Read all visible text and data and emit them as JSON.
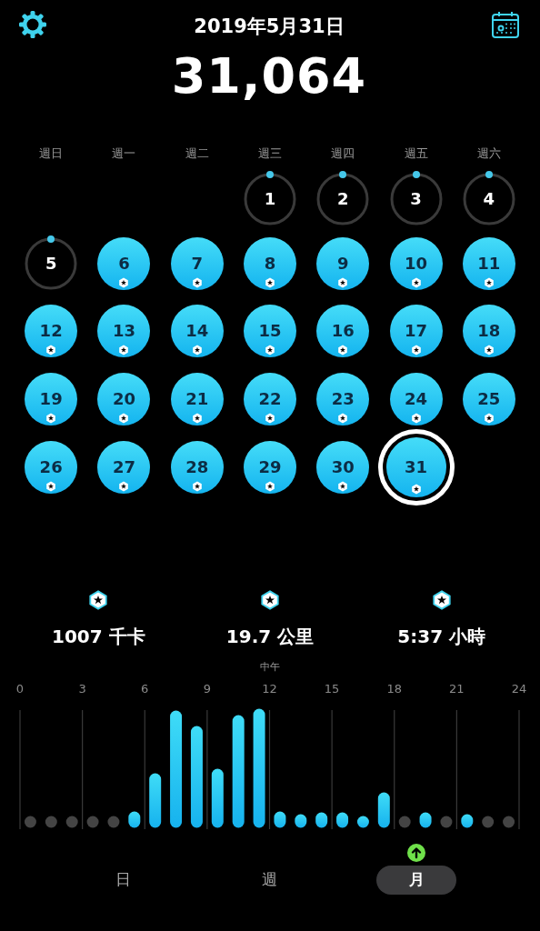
{
  "header": {
    "date": "2019年5月31日",
    "steps": "31,064"
  },
  "weekdays": [
    "週日",
    "週一",
    "週二",
    "週三",
    "週四",
    "週五",
    "週六"
  ],
  "weeks": [
    [
      {
        "day": "1",
        "kind": "ring",
        "selected": false
      },
      {
        "day": "2",
        "kind": "ring",
        "selected": false
      },
      {
        "day": "3",
        "kind": "ring",
        "selected": false
      },
      {
        "day": "4",
        "kind": "ring",
        "selected": false
      }
    ],
    [
      {
        "day": "5",
        "kind": "ring",
        "selected": false
      },
      {
        "day": "6",
        "kind": "goal",
        "selected": false
      },
      {
        "day": "7",
        "kind": "goal",
        "selected": false
      },
      {
        "day": "8",
        "kind": "goal",
        "selected": false
      },
      {
        "day": "9",
        "kind": "goal",
        "selected": false
      },
      {
        "day": "10",
        "kind": "goal",
        "selected": false
      },
      {
        "day": "11",
        "kind": "goal",
        "selected": false
      }
    ],
    [
      {
        "day": "12",
        "kind": "goal",
        "selected": false
      },
      {
        "day": "13",
        "kind": "goal",
        "selected": false
      },
      {
        "day": "14",
        "kind": "goal",
        "selected": false
      },
      {
        "day": "15",
        "kind": "goal",
        "selected": false
      },
      {
        "day": "16",
        "kind": "goal",
        "selected": false
      },
      {
        "day": "17",
        "kind": "goal",
        "selected": false
      },
      {
        "day": "18",
        "kind": "goal",
        "selected": false
      }
    ],
    [
      {
        "day": "19",
        "kind": "goal",
        "selected": false
      },
      {
        "day": "20",
        "kind": "goal",
        "selected": false
      },
      {
        "day": "21",
        "kind": "goal",
        "selected": false
      },
      {
        "day": "22",
        "kind": "goal",
        "selected": false
      },
      {
        "day": "23",
        "kind": "goal",
        "selected": false
      },
      {
        "day": "24",
        "kind": "goal",
        "selected": false
      },
      {
        "day": "25",
        "kind": "goal",
        "selected": false
      }
    ],
    [
      {
        "day": "26",
        "kind": "goal",
        "selected": false
      },
      {
        "day": "27",
        "kind": "goal",
        "selected": false
      },
      {
        "day": "28",
        "kind": "goal",
        "selected": false
      },
      {
        "day": "29",
        "kind": "goal",
        "selected": false
      },
      {
        "day": "30",
        "kind": "goal",
        "selected": false
      },
      {
        "day": "31",
        "kind": "goal",
        "selected": true
      }
    ]
  ],
  "stats": [
    "1007 千卡",
    "19.7 公里",
    "5:37 小時"
  ],
  "chart": {
    "noon_label": "中午",
    "hour_ticks": [
      "0",
      "3",
      "6",
      "9",
      "12",
      "15",
      "18",
      "21",
      "24"
    ]
  },
  "tabs": [
    {
      "label": "日",
      "selected": false,
      "trend_up": false
    },
    {
      "label": "週",
      "selected": false,
      "trend_up": false
    },
    {
      "label": "月",
      "selected": true,
      "trend_up": true
    }
  ]
}
